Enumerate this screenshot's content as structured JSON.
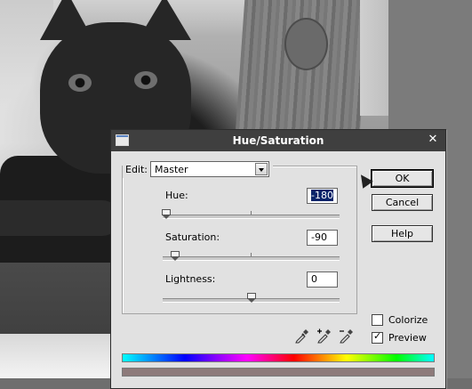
{
  "dialog": {
    "title": "Hue/Saturation",
    "edit_label": "Edit:",
    "edit_value": "Master",
    "hue_label": "Hue:",
    "hue_value": "-180",
    "hue_level": -180,
    "saturation_label": "Saturation:",
    "saturation_value": "-90",
    "saturation_level": -90,
    "lightness_label": "Lightness:",
    "lightness_value": "0",
    "lightness_level": 0,
    "ok_label": "OK",
    "cancel_label": "Cancel",
    "help_label": "Help",
    "colorize_label": "Colorize",
    "colorize_checked": false,
    "preview_label": "Preview",
    "preview_checked": true,
    "close_glyph": "✕"
  },
  "icons": {
    "titlebar": "window-icon",
    "close": "close-icon",
    "eyedropper": "eyedropper-icon",
    "eyedropper_plus": "eyedropper-plus-icon",
    "eyedropper_minus": "eyedropper-minus-icon",
    "dropdown": "chevron-down-icon"
  },
  "colors": {
    "titlebar": "#3f3f3f",
    "dialog_bg": "#e1e1e1",
    "selection": "#0a246a",
    "adjusted_bar": "#8d7a7a"
  }
}
